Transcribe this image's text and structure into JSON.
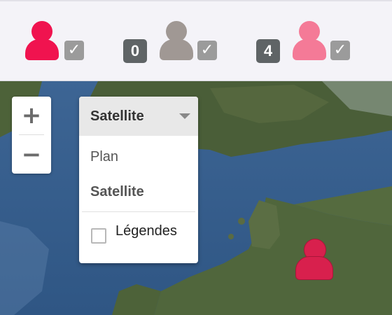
{
  "filters": [
    {
      "count": "",
      "color": "#f0134f",
      "checked": "✓",
      "icon": "person-icon"
    },
    {
      "count": "0",
      "color": "#a09894",
      "checked": "✓",
      "icon": "person-icon"
    },
    {
      "count": "4",
      "color": "#f47a97",
      "checked": "✓",
      "icon": "person-icon"
    }
  ],
  "zoom": {
    "in_label": "+",
    "out_label": "−"
  },
  "map_type": {
    "selected": "Satellite",
    "options": [
      "Plan",
      "Satellite"
    ],
    "legend_checkbox_label": "Légendes",
    "legend_checked": false
  },
  "marker": {
    "icon": "person-marker-icon",
    "color": "#d8204d"
  }
}
